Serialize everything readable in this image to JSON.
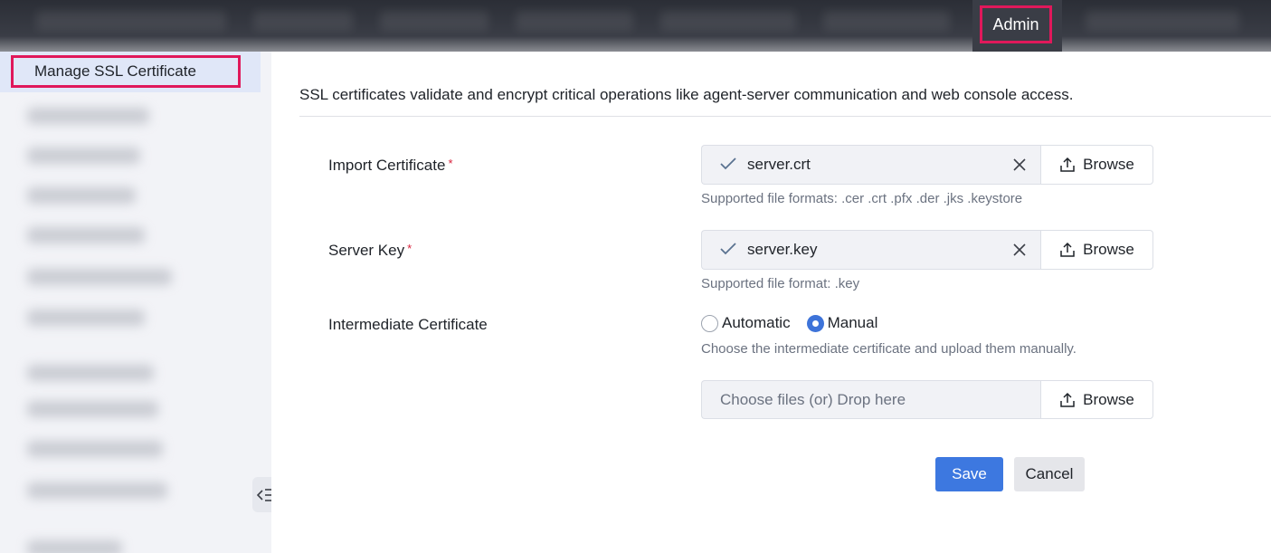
{
  "topbar": {
    "admin_label": "Admin"
  },
  "sidebar": {
    "active_item": "Manage SSL Certificate",
    "collapse_icon": "collapse-sidebar-icon"
  },
  "main": {
    "description": "SSL certificates validate and encrypt critical operations like agent-server communication and web console access.",
    "import_certificate": {
      "label": "Import Certificate",
      "required_mark": "*",
      "file_name": "server.crt",
      "browse_label": "Browse",
      "hint": "Supported file formats: .cer .crt .pfx .der .jks .keystore"
    },
    "server_key": {
      "label": "Server Key",
      "required_mark": "*",
      "file_name": "server.key",
      "browse_label": "Browse",
      "hint": "Supported file format: .key"
    },
    "intermediate_certificate": {
      "label": "Intermediate Certificate",
      "options": [
        "Automatic",
        "Manual"
      ],
      "selected": "Manual",
      "hint": "Choose the intermediate certificate and upload them manually.",
      "drop_placeholder": "Choose files (or) Drop here",
      "browse_label": "Browse"
    },
    "save_label": "Save",
    "cancel_label": "Cancel"
  },
  "colors": {
    "primary": "#3d78e0",
    "highlight_border": "#e0185b",
    "required": "#d8213b"
  }
}
